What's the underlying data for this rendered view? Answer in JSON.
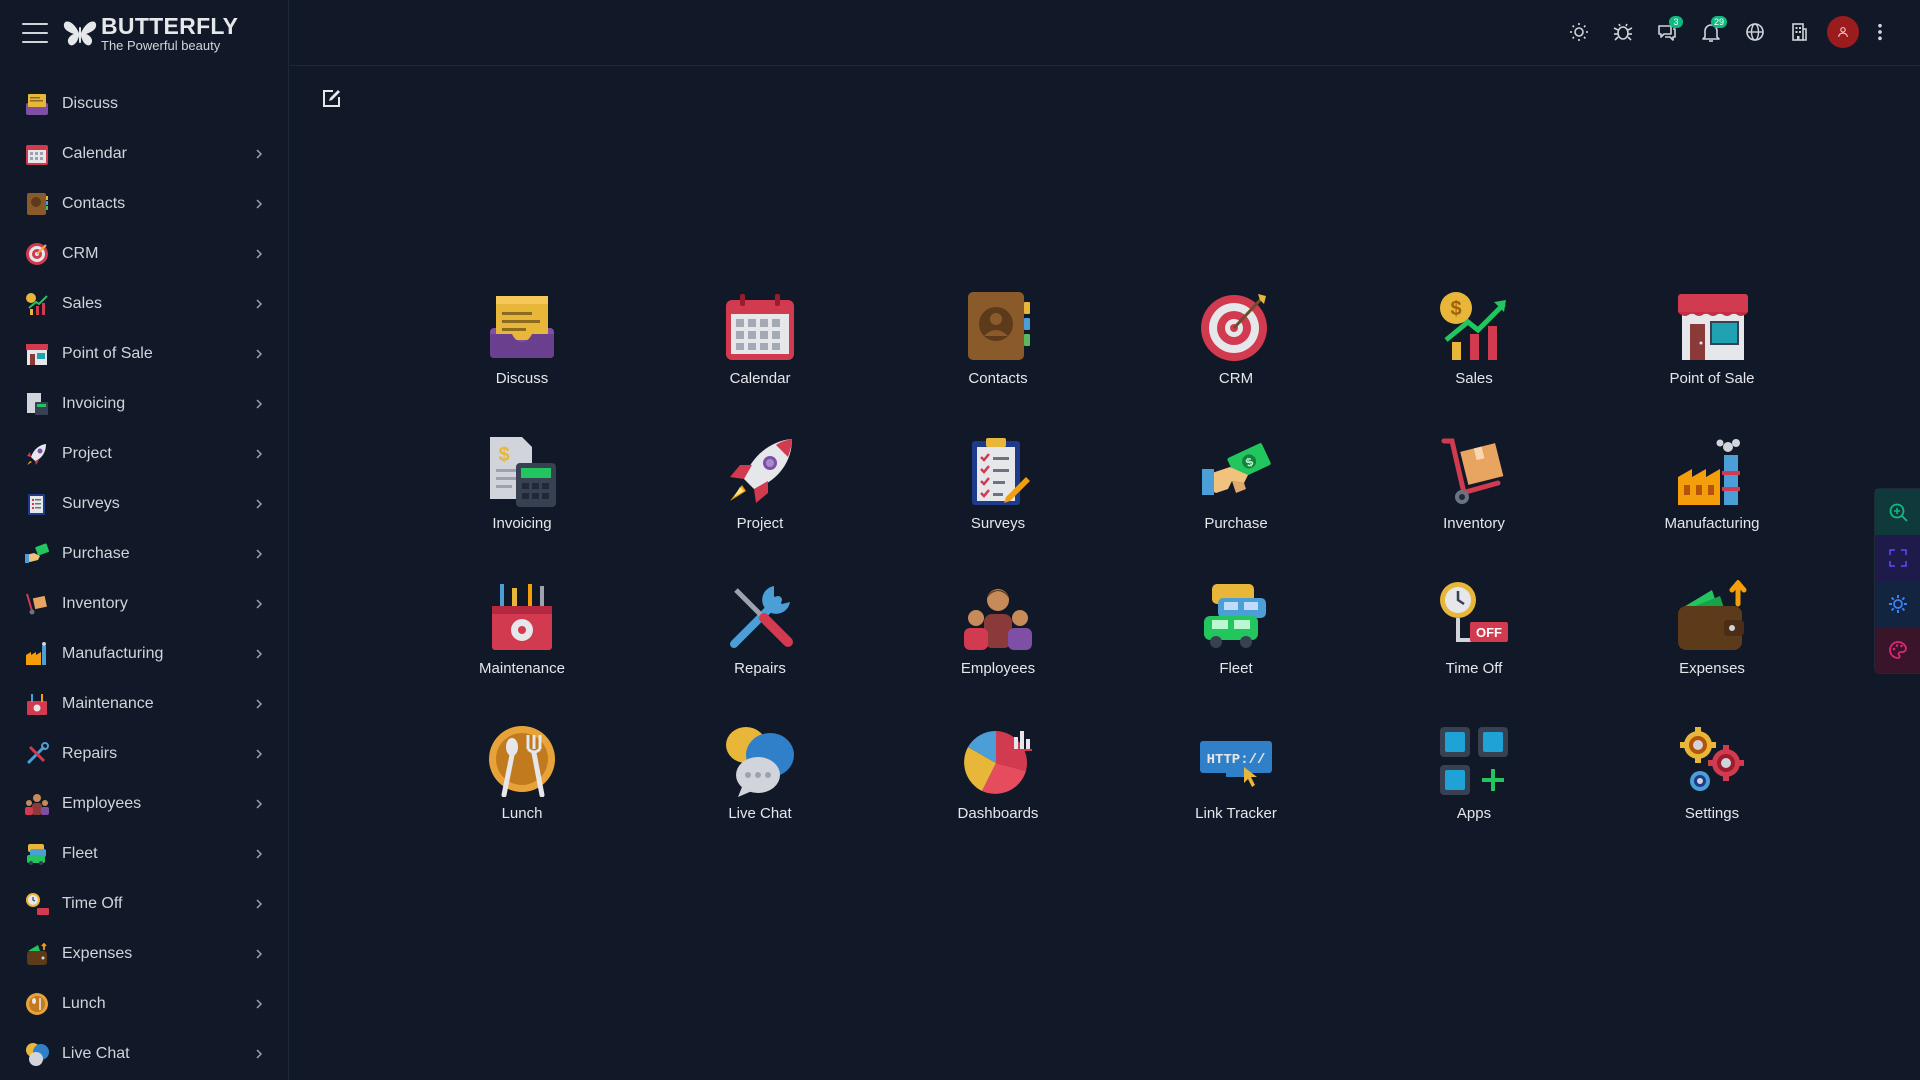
{
  "brand": {
    "title": "BUTTERFLY",
    "subtitle": "The Powerful beauty"
  },
  "sidebar": {
    "items": [
      {
        "label": "Discuss",
        "icon": "discuss-icon",
        "has_submenu": false
      },
      {
        "label": "Calendar",
        "icon": "calendar-icon",
        "has_submenu": true
      },
      {
        "label": "Contacts",
        "icon": "contacts-icon",
        "has_submenu": true
      },
      {
        "label": "CRM",
        "icon": "crm-icon",
        "has_submenu": true
      },
      {
        "label": "Sales",
        "icon": "sales-icon",
        "has_submenu": true
      },
      {
        "label": "Point of Sale",
        "icon": "point-of-sale-icon",
        "has_submenu": true
      },
      {
        "label": "Invoicing",
        "icon": "invoicing-icon",
        "has_submenu": true
      },
      {
        "label": "Project",
        "icon": "project-icon",
        "has_submenu": true
      },
      {
        "label": "Surveys",
        "icon": "surveys-icon",
        "has_submenu": true
      },
      {
        "label": "Purchase",
        "icon": "purchase-icon",
        "has_submenu": true
      },
      {
        "label": "Inventory",
        "icon": "inventory-icon",
        "has_submenu": true
      },
      {
        "label": "Manufacturing",
        "icon": "manufacturing-icon",
        "has_submenu": true
      },
      {
        "label": "Maintenance",
        "icon": "maintenance-icon",
        "has_submenu": true
      },
      {
        "label": "Repairs",
        "icon": "repairs-icon",
        "has_submenu": true
      },
      {
        "label": "Employees",
        "icon": "employees-icon",
        "has_submenu": true
      },
      {
        "label": "Fleet",
        "icon": "fleet-icon",
        "has_submenu": true
      },
      {
        "label": "Time Off",
        "icon": "time-off-icon",
        "has_submenu": true
      },
      {
        "label": "Expenses",
        "icon": "expenses-icon",
        "has_submenu": true
      },
      {
        "label": "Lunch",
        "icon": "lunch-icon",
        "has_submenu": true
      },
      {
        "label": "Live Chat",
        "icon": "live-chat-icon",
        "has_submenu": true
      }
    ]
  },
  "topbar": {
    "icons": [
      {
        "name": "theme-toggle-icon"
      },
      {
        "name": "debug-icon"
      },
      {
        "name": "messages-icon",
        "badge": "3"
      },
      {
        "name": "notifications-icon",
        "badge": "29"
      },
      {
        "name": "language-icon"
      },
      {
        "name": "company-icon"
      },
      {
        "name": "user-avatar"
      },
      {
        "name": "more-menu-icon"
      }
    ]
  },
  "apps": [
    {
      "label": "Discuss",
      "icon": "discuss-icon"
    },
    {
      "label": "Calendar",
      "icon": "calendar-icon"
    },
    {
      "label": "Contacts",
      "icon": "contacts-icon"
    },
    {
      "label": "CRM",
      "icon": "crm-icon"
    },
    {
      "label": "Sales",
      "icon": "sales-icon"
    },
    {
      "label": "Point of Sale",
      "icon": "point-of-sale-icon"
    },
    {
      "label": "Invoicing",
      "icon": "invoicing-icon"
    },
    {
      "label": "Project",
      "icon": "project-icon"
    },
    {
      "label": "Surveys",
      "icon": "surveys-icon"
    },
    {
      "label": "Purchase",
      "icon": "purchase-icon"
    },
    {
      "label": "Inventory",
      "icon": "inventory-icon"
    },
    {
      "label": "Manufacturing",
      "icon": "manufacturing-icon"
    },
    {
      "label": "Maintenance",
      "icon": "maintenance-icon"
    },
    {
      "label": "Repairs",
      "icon": "repairs-icon"
    },
    {
      "label": "Employees",
      "icon": "employees-icon"
    },
    {
      "label": "Fleet",
      "icon": "fleet-icon"
    },
    {
      "label": "Time Off",
      "icon": "time-off-icon",
      "icon_text": "OFF"
    },
    {
      "label": "Expenses",
      "icon": "expenses-icon"
    },
    {
      "label": "Lunch",
      "icon": "lunch-icon"
    },
    {
      "label": "Live Chat",
      "icon": "live-chat-icon"
    },
    {
      "label": "Dashboards",
      "icon": "dashboards-icon"
    },
    {
      "label": "Link Tracker",
      "icon": "link-tracker-icon",
      "icon_text": "HTTP://"
    },
    {
      "label": "Apps",
      "icon": "apps-icon"
    },
    {
      "label": "Settings",
      "icon": "settings-icon"
    }
  ],
  "side_tools": [
    {
      "name": "zoom-in-icon"
    },
    {
      "name": "fullscreen-icon"
    },
    {
      "name": "customize-icon"
    },
    {
      "name": "theme-palette-icon"
    }
  ],
  "colors": {
    "background": "#111827",
    "border": "#1f2937",
    "text": "#e5e7eb",
    "badge": "#10b981",
    "avatar": "#9b1c1c"
  }
}
